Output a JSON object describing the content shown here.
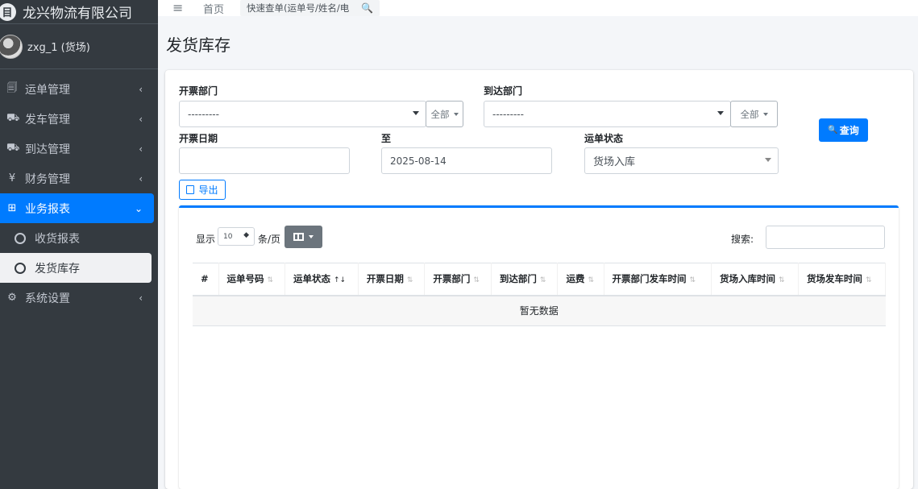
{
  "brand": {
    "logo_glyph": "目",
    "name": "龙兴物流有限公司"
  },
  "user": {
    "name": "zxg_1 (货场)"
  },
  "sidebar": {
    "items": [
      {
        "icon": "clipboard-icon",
        "glyph": "🗐",
        "label": "运单管理",
        "chevron": "‹"
      },
      {
        "icon": "truck-icon",
        "glyph": "⛟",
        "label": "发车管理",
        "chevron": "‹"
      },
      {
        "icon": "truck-loading-icon",
        "glyph": "⛟",
        "label": "到达管理",
        "chevron": "‹"
      },
      {
        "icon": "yen-icon",
        "glyph": "¥",
        "label": "财务管理",
        "chevron": "‹"
      },
      {
        "icon": "table-icon",
        "glyph": "⊞",
        "label": "业务报表",
        "chevron": "⌄"
      }
    ],
    "subitems": [
      {
        "label": "收货报表"
      },
      {
        "label": "发货库存"
      }
    ],
    "settings": {
      "glyph": "⚙",
      "label": "系统设置",
      "chevron": "‹"
    }
  },
  "topbar": {
    "menu_glyph": "≡",
    "home": "首页",
    "quick_placeholder": "快速查单(运单号/姓名/电",
    "search_glyph": "🔍"
  },
  "page": {
    "title": "发货库存"
  },
  "filters": {
    "issue_dept_label": "开票部门",
    "issue_dept_value": "---------",
    "issue_dept_all": "全部",
    "arrive_dept_label": "到达部门",
    "arrive_dept_value": "---------",
    "arrive_dept_all": "全部",
    "issue_date_label": "开票日期",
    "issue_date_value": "",
    "to_label": "至",
    "to_value": "2025-08-14",
    "status_label": "运单状态",
    "status_value": "货场入库",
    "query_button": "查询",
    "query_glyph": "🔍",
    "export_button": "导出"
  },
  "table": {
    "show_label": "显示",
    "page_length": "10",
    "per_page_label": "条/页",
    "search_label": "搜索:",
    "columns": [
      {
        "label": "#",
        "sort": ""
      },
      {
        "label": "运单号码",
        "sort": "⇅"
      },
      {
        "label": "运单状态",
        "sort": "↑↓"
      },
      {
        "label": "开票日期",
        "sort": "⇅"
      },
      {
        "label": "开票部门",
        "sort": "⇅"
      },
      {
        "label": "到达部门",
        "sort": "⇅"
      },
      {
        "label": "运费",
        "sort": "⇅"
      },
      {
        "label": "开票部门发车时间",
        "sort": "⇅"
      },
      {
        "label": "货场入库时间",
        "sort": "⇅"
      },
      {
        "label": "货场发车时间",
        "sort": "⇅"
      }
    ],
    "empty_text": "暂无数据"
  },
  "colors": {
    "primary": "#007bff",
    "sidebar_bg": "#343a40",
    "secondary": "#6c757d"
  }
}
